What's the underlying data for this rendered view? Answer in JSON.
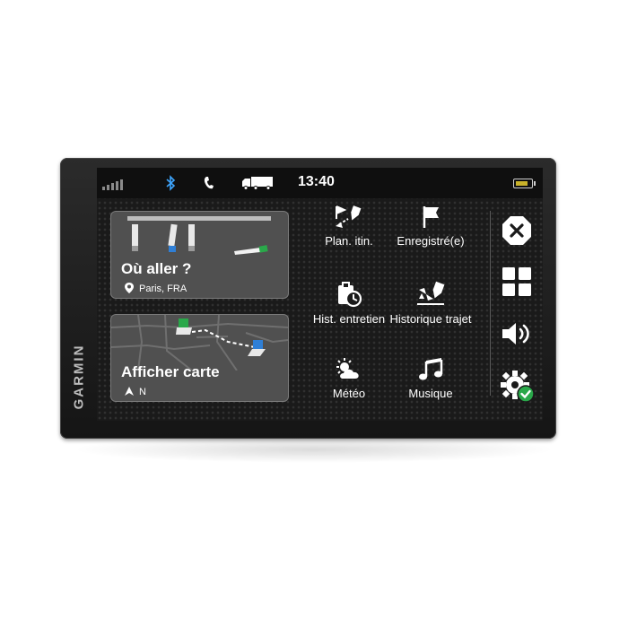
{
  "brand": "GARMIN",
  "status": {
    "time": "13:40",
    "icons": [
      "signal-icon",
      "bluetooth-icon",
      "phone-icon",
      "truck-icon",
      "battery-icon"
    ]
  },
  "cards": {
    "where_to": {
      "title": "Où aller ?",
      "location": "Paris, FRA"
    },
    "show_map": {
      "title": "Afficher carte",
      "heading": "N"
    }
  },
  "apps": [
    {
      "label": "Plan. itin.",
      "icon": "trip-planner-icon"
    },
    {
      "label": "Enregistré(e)",
      "icon": "flag-icon"
    },
    {
      "label": "Hist. entretien",
      "icon": "maintenance-history-icon"
    },
    {
      "label": "Historique trajet",
      "icon": "trip-history-icon"
    },
    {
      "label": "Météo",
      "icon": "weather-icon"
    },
    {
      "label": "Musique",
      "icon": "music-icon"
    }
  ],
  "sidebar": [
    "close-icon",
    "apps-grid-icon",
    "volume-icon",
    "settings-icon"
  ],
  "colors": {
    "accent_green": "#2aa84a",
    "bluetooth_blue": "#3ea6ff",
    "battery_fill": "#c9b22a"
  }
}
